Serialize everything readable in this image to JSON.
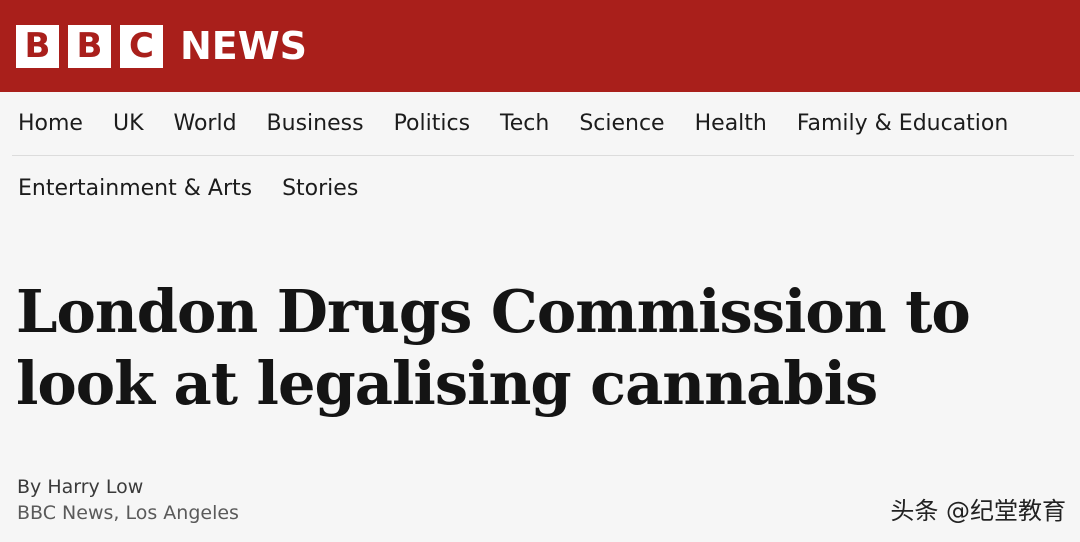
{
  "header": {
    "logo_letters": [
      "B",
      "B",
      "C"
    ],
    "logo_word": "NEWS",
    "brand_color": "#a91f1b"
  },
  "nav": {
    "row1": [
      "Home",
      "UK",
      "World",
      "Business",
      "Politics",
      "Tech",
      "Science",
      "Health",
      "Family & Education"
    ],
    "row2": [
      "Entertainment & Arts",
      "Stories"
    ]
  },
  "article": {
    "headline": "London Drugs Commission to look at legalising cannabis",
    "byline_author": "By Harry Low",
    "byline_source": "BBC News, Los Angeles"
  },
  "watermark": {
    "text": "头条 @纪堂教育"
  }
}
